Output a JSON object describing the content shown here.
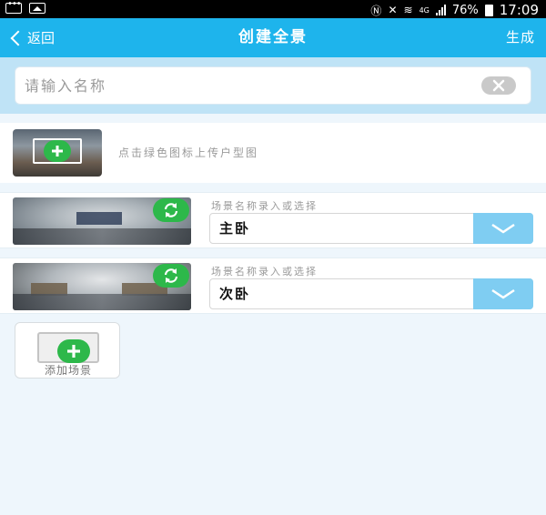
{
  "status_bar": {
    "network": "4G",
    "battery": "76%",
    "time": "17:09"
  },
  "header": {
    "back_label": "返回",
    "title": "创建全景",
    "generate_label": "生成"
  },
  "name_field": {
    "placeholder": "请输入名称",
    "value": ""
  },
  "cover": {
    "hint": "点击绿色图标上传户型图"
  },
  "scenes": [
    {
      "hint": "场景名称录入或选择",
      "value": "主卧"
    },
    {
      "hint": "场景名称录入或选择",
      "value": "次卧"
    }
  ],
  "add_scene": {
    "label": "添加场景"
  },
  "colors": {
    "header_bg": "#1eb4ec",
    "accent_green": "#2db84a",
    "dropdown_blue": "#7fcdf2"
  }
}
